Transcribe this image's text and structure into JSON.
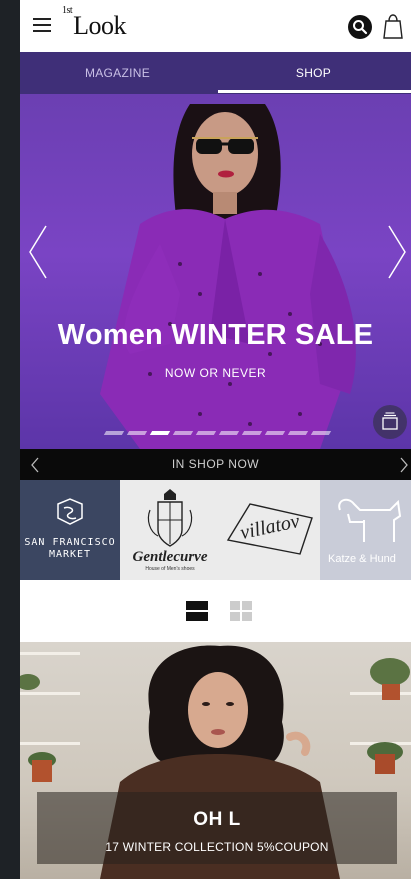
{
  "header": {
    "logo_sup": "1st",
    "logo_text": "Look"
  },
  "tabs": [
    {
      "label": "MAGAZINE",
      "active": false
    },
    {
      "label": "SHOP",
      "active": true
    }
  ],
  "hero": {
    "title": "Women WINTER SALE",
    "subtitle": "NOW OR NEVER",
    "slide_count": 10,
    "active_slide": 3
  },
  "shop_bar": {
    "label": "IN SHOP NOW"
  },
  "brands": [
    {
      "name": "SAN FRANCISCO MARKET"
    },
    {
      "name": "Gentlecurve",
      "tagline": "House of Men's shoes"
    },
    {
      "name": "villatov"
    },
    {
      "name": "Katze & Hund"
    }
  ],
  "view_toggle": {
    "selected": "list"
  },
  "product_card": {
    "title": "OH L",
    "subtitle": "17 WINTER COLLECTION 5%COUPON"
  },
  "icons": [
    "menu-icon",
    "search-icon",
    "cart-icon",
    "chevron-left-icon",
    "chevron-right-icon",
    "gallery-icon",
    "list-view-icon",
    "grid-view-icon"
  ],
  "colors": {
    "tab_bar": "#3f2f78",
    "hero_purple": "#7a44c4",
    "shop_bar": "#0a0a0a",
    "brand_sf": "#3b4661",
    "brand_kh": "#c9ccd8"
  }
}
